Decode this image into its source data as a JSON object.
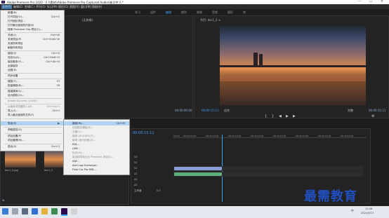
{
  "window": {
    "title": "Adobe Premiere Pro 2020 - E:\\\\素材\\\\Adobe Premiere Pro Captured Audio\\\\新文件 \\\\ *",
    "controls": [
      "—",
      "☐",
      "✕"
    ]
  },
  "menubar": {
    "items": [
      "文件(F)",
      "编辑(E)",
      "剪辑(C)",
      "序列(S)",
      "标记(M)",
      "图形(G)",
      "视图(V)",
      "窗口(W)",
      "帮助(H)"
    ]
  },
  "workspaces": {
    "items": [
      "学习",
      "组件",
      "编辑",
      "颜色",
      "效果",
      "音频",
      "图形",
      "库"
    ],
    "active_index": 2
  },
  "source_panel": {
    "tab": "(无剪辑)",
    "timecode": "00:00:00:00"
  },
  "program_panel": {
    "tab": "节目: dsc1_2 ≡",
    "timecode_left": "00:00:15:11",
    "fit": "适合",
    "quality": "完整",
    "timecode_right": "00:00:15:11"
  },
  "file_menu": {
    "items": [
      {
        "label": "新建(N)",
        "shortcut": "",
        "disabled": false
      },
      {
        "label": "打开项目(O)...",
        "shortcut": "Ctrl+O",
        "disabled": false
      },
      {
        "label": "打开团队项目...",
        "shortcut": "",
        "disabled": false
      },
      {
        "label": "打开最近使用的内容(E)",
        "shortcut": "",
        "disabled": false
      },
      {
        "label": "转换 Premiere Clip 项目(C)...",
        "shortcut": "",
        "disabled": false
      },
      {
        "label": "关闭(C)",
        "shortcut": "Ctrl+W",
        "disabled": false
      },
      {
        "label": "关闭项目(P)",
        "shortcut": "Ctrl+Shift+W",
        "disabled": false
      },
      {
        "label": "关闭所有项目",
        "shortcut": "",
        "disabled": false
      },
      {
        "label": "刷新所有项目",
        "shortcut": "",
        "disabled": false
      },
      {
        "label": "保存(S)",
        "shortcut": "Ctrl+S",
        "disabled": false
      },
      {
        "label": "另存为(A)...",
        "shortcut": "Ctrl+Shift+S",
        "disabled": false
      },
      {
        "label": "保存副本(Y)...",
        "shortcut": "Ctrl+Alt+S",
        "disabled": false
      },
      {
        "label": "全部保存",
        "shortcut": "",
        "disabled": false
      },
      {
        "label": "还原(R)",
        "shortcut": "",
        "disabled": false
      },
      {
        "label": "同步设置",
        "shortcut": "",
        "disabled": false
      },
      {
        "label": "捕捉(T)...",
        "shortcut": "F5",
        "disabled": false
      },
      {
        "label": "批量捕捉(B)...",
        "shortcut": "F6",
        "disabled": false
      },
      {
        "label": "链接媒体(L)...",
        "shortcut": "",
        "disabled": false
      },
      {
        "label": "设为脱机(O)...",
        "shortcut": "",
        "disabled": false
      },
      {
        "label": "Adobe Dynamic Link(K)",
        "shortcut": "",
        "disabled": true
      },
      {
        "label": "从媒体浏览器导入(M)",
        "shortcut": "Ctrl+Alt+I",
        "disabled": true
      },
      {
        "label": "导入(I)...",
        "shortcut": "Ctrl+I",
        "disabled": false
      },
      {
        "label": "导入最近使用的文件(F)",
        "shortcut": "",
        "disabled": false
      },
      {
        "label": "导出(E)",
        "shortcut": "",
        "disabled": false
      },
      {
        "label": "获取属性(G)",
        "shortcut": "",
        "disabled": false
      },
      {
        "label": "项目设置(P)",
        "shortcut": "",
        "disabled": false
      },
      {
        "label": "项目管理(M)...",
        "shortcut": "",
        "disabled": false
      },
      {
        "label": "退出(X)",
        "shortcut": "Ctrl+Q",
        "disabled": false
      }
    ]
  },
  "export_submenu": {
    "items": [
      {
        "label": "媒体(M)...",
        "shortcut": "Ctrl+M",
        "disabled": false
      },
      {
        "label": "动态图形模板(R)...",
        "shortcut": "",
        "disabled": true
      },
      {
        "label": "字幕(C)...",
        "shortcut": "",
        "disabled": true
      },
      {
        "label": "磁带 (DV/HDV)(T)...",
        "shortcut": "",
        "disabled": true
      },
      {
        "label": "磁带 (串行设备)(S)...",
        "shortcut": "",
        "disabled": true
      },
      {
        "label": "EDL...",
        "shortcut": "",
        "disabled": false
      },
      {
        "label": "OMF...",
        "shortcut": "",
        "disabled": false
      },
      {
        "label": "标记(M)...",
        "shortcut": "",
        "disabled": true
      },
      {
        "label": "将选择项导出为 Premiere 项目(S)...",
        "shortcut": "",
        "disabled": true
      },
      {
        "label": "AAF...",
        "shortcut": "",
        "disabled": false
      },
      {
        "label": "Avid Log Exchange...",
        "shortcut": "",
        "disabled": false
      },
      {
        "label": "Final Cut Pro XML...",
        "shortcut": "",
        "disabled": false
      }
    ]
  },
  "timeline": {
    "timecode": "00:00:15:11",
    "ruler": [
      "00:00",
      "00:00:05:00",
      "00:00:10:00",
      "00:00:15:00",
      "00:00:20:00",
      "00:00:25:00",
      "00:00:30:00",
      "00:00:35:00",
      "00:00:40:00"
    ],
    "tracks": [
      "V3",
      "V2",
      "V1",
      "A1",
      "A2",
      "A3"
    ],
    "master": "主声道",
    "master_value": "0.0"
  },
  "project_panel": {
    "thumb1": "dsc1_2.jpg",
    "thumb2": "dsc1_2"
  },
  "taskbar": {
    "time": "12:06",
    "date": "2021/5/17",
    "lang": "中"
  },
  "watermark": "最需教育"
}
